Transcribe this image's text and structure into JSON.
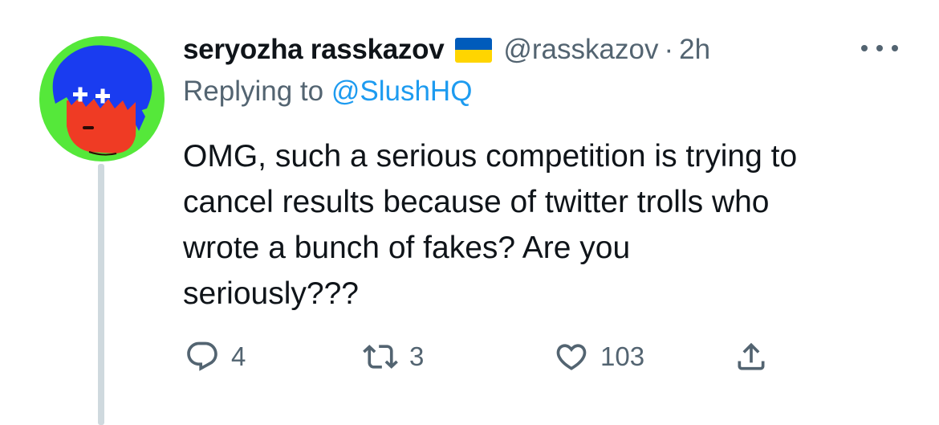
{
  "tweet": {
    "author": {
      "display_name": "seryozha rasskazov",
      "handle": "@rasskazov",
      "flag": {
        "top_color": "#005bbb",
        "bottom_color": "#ffd500"
      }
    },
    "separator": "·",
    "time": "2h",
    "reply_prefix": "Replying to",
    "reply_to": "@SlushHQ",
    "text_lines": [
      "OMG, such a serious competition is trying to",
      "cancel results because of twitter trolls who",
      "wrote a bunch of fakes? Are you",
      "seriously???"
    ]
  },
  "actions": {
    "reply": {
      "icon": "reply-icon",
      "count": "4"
    },
    "retweet": {
      "icon": "retweet-icon",
      "count": "3"
    },
    "like": {
      "icon": "heart-icon",
      "count": "103"
    },
    "share": {
      "icon": "share-icon"
    }
  },
  "colors": {
    "text": "#0f1419",
    "muted": "#536471",
    "link": "#1d9bf0",
    "thread_line": "#cfd9de",
    "avatar_bg": "#55e83a",
    "avatar_hair": "#1a3cf0",
    "avatar_face": "#ef3b24"
  }
}
